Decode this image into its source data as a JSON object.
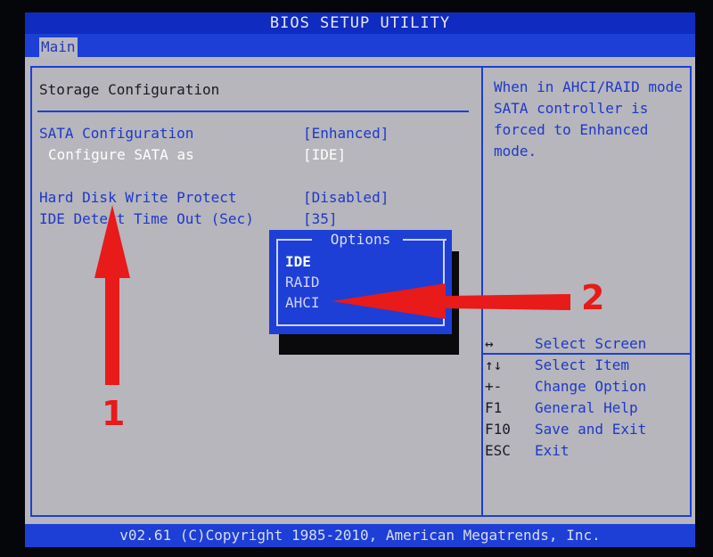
{
  "app": {
    "title": "BIOS SETUP UTILITY",
    "menu": {
      "tab_main": "Main"
    }
  },
  "section": {
    "title": "Storage Configuration"
  },
  "options": [
    {
      "label": "SATA Configuration",
      "value": "[Enhanced]"
    },
    {
      "label": "Configure SATA as",
      "value": "[IDE]"
    },
    {
      "label": "Hard Disk Write Protect",
      "value": "[Disabled]"
    },
    {
      "label": "IDE Detect Time Out (Sec)",
      "value": "[35]"
    }
  ],
  "help": {
    "text": "When in AHCI/RAID mode SATA controller is forced to Enhanced mode."
  },
  "popup": {
    "title": "Options",
    "items": [
      "IDE",
      "RAID",
      "AHCI"
    ]
  },
  "keys": [
    {
      "key": "↔",
      "desc": "Select Screen"
    },
    {
      "key": "↑↓",
      "desc": "Select Item"
    },
    {
      "key": "+-",
      "desc": "Change Option"
    },
    {
      "key": "F1",
      "desc": "General Help"
    },
    {
      "key": "F10",
      "desc": "Save and Exit"
    },
    {
      "key": "ESC",
      "desc": "Exit"
    }
  ],
  "footer": {
    "text": "v02.61 (C)Copyright 1985-2010, American Megatrends, Inc."
  },
  "annotations": {
    "arrow1_label": "1",
    "arrow2_label": "2"
  },
  "colors": {
    "bios_blue": "#1d3fd6",
    "screen_gray": "#b6b6bc",
    "annotation_red": "#e81a1a"
  }
}
